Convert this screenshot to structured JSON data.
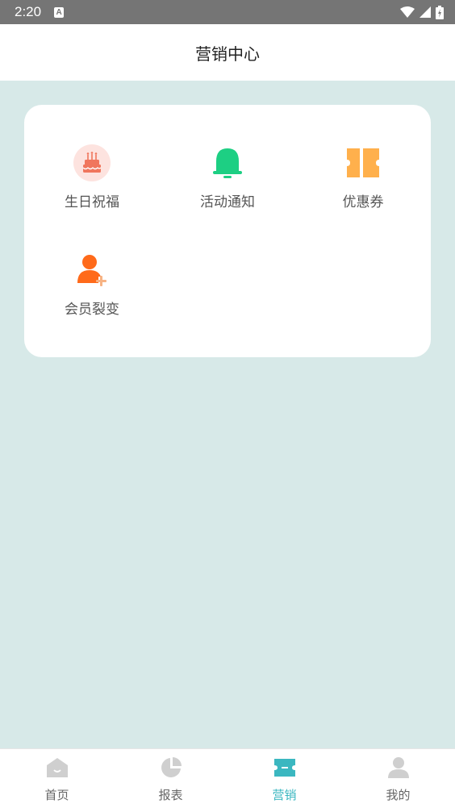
{
  "status_bar": {
    "time": "2:20",
    "notification_icon": "a-icon",
    "icons": [
      "wifi-icon",
      "signal-icon",
      "battery-icon"
    ]
  },
  "header": {
    "title": "营销中心"
  },
  "grid": {
    "items": [
      {
        "label": "生日祝福",
        "icon": "birthday-cake-icon",
        "color": "#f0765d"
      },
      {
        "label": "活动通知",
        "icon": "bell-icon",
        "color": "#1dcf83"
      },
      {
        "label": "优惠券",
        "icon": "coupon-icon",
        "color": "#ffb04c"
      },
      {
        "label": "会员裂变",
        "icon": "member-add-icon",
        "color": "#ff6a1a"
      }
    ]
  },
  "tabbar": {
    "active": "营销",
    "active_color": "#3bb7c0",
    "tabs": [
      {
        "label": "首页",
        "icon": "home-icon"
      },
      {
        "label": "报表",
        "icon": "pie-chart-icon"
      },
      {
        "label": "营销",
        "icon": "ticket-icon"
      },
      {
        "label": "我的",
        "icon": "user-icon"
      }
    ]
  }
}
